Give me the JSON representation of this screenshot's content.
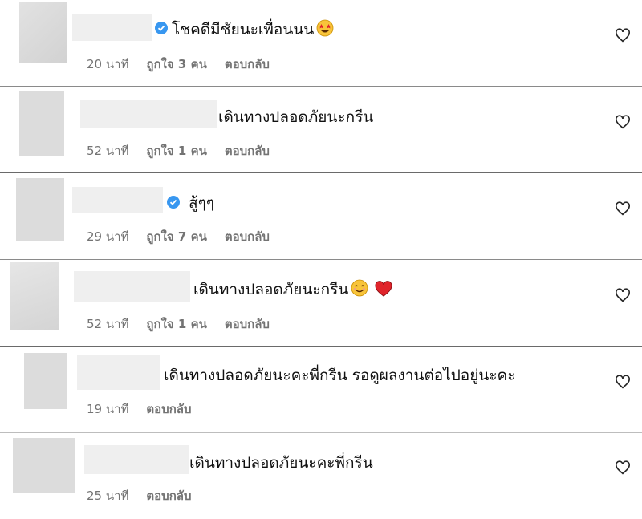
{
  "comments": [
    {
      "text": "โชคดีมีชัยนะเพื่อนนน",
      "emoji": "star-eyes",
      "verified": true,
      "time": "20 นาที",
      "likes": "ถูกใจ 3 คน",
      "reply": "ตอบกลับ"
    },
    {
      "text": "เดินทางปลอดภัยนะกรีน",
      "emoji": "",
      "verified": false,
      "time": "52 นาที",
      "likes": "ถูกใจ 1 คน",
      "reply": "ตอบกลับ"
    },
    {
      "text": "สู้ๆๆ",
      "emoji": "",
      "verified": true,
      "time": "29 นาที",
      "likes": "ถูกใจ 7 คน",
      "reply": "ตอบกลับ"
    },
    {
      "text": "เดินทางปลอดภัยนะกรีน",
      "emoji": "smile-heart",
      "verified": false,
      "time": "52 นาที",
      "likes": "ถูกใจ 1 คน",
      "reply": "ตอบกลับ"
    },
    {
      "text": "เดินทางปลอดภัยนะคะพี่กรีน รอดูผลงานต่อไปอยู่นะคะ",
      "emoji": "",
      "verified": false,
      "time": "19 นาที",
      "likes": "",
      "reply": "ตอบกลับ"
    },
    {
      "text": "เดินทางปลอดภัยนะคะพี่กรีน",
      "emoji": "",
      "verified": false,
      "time": "25 นาที",
      "likes": "",
      "reply": "ตอบกลับ"
    }
  ],
  "icons": {
    "heart": "heart-outline-icon",
    "verified": "verified-badge-icon"
  },
  "colors": {
    "verified": "#3897f0",
    "meta": "#737373"
  }
}
